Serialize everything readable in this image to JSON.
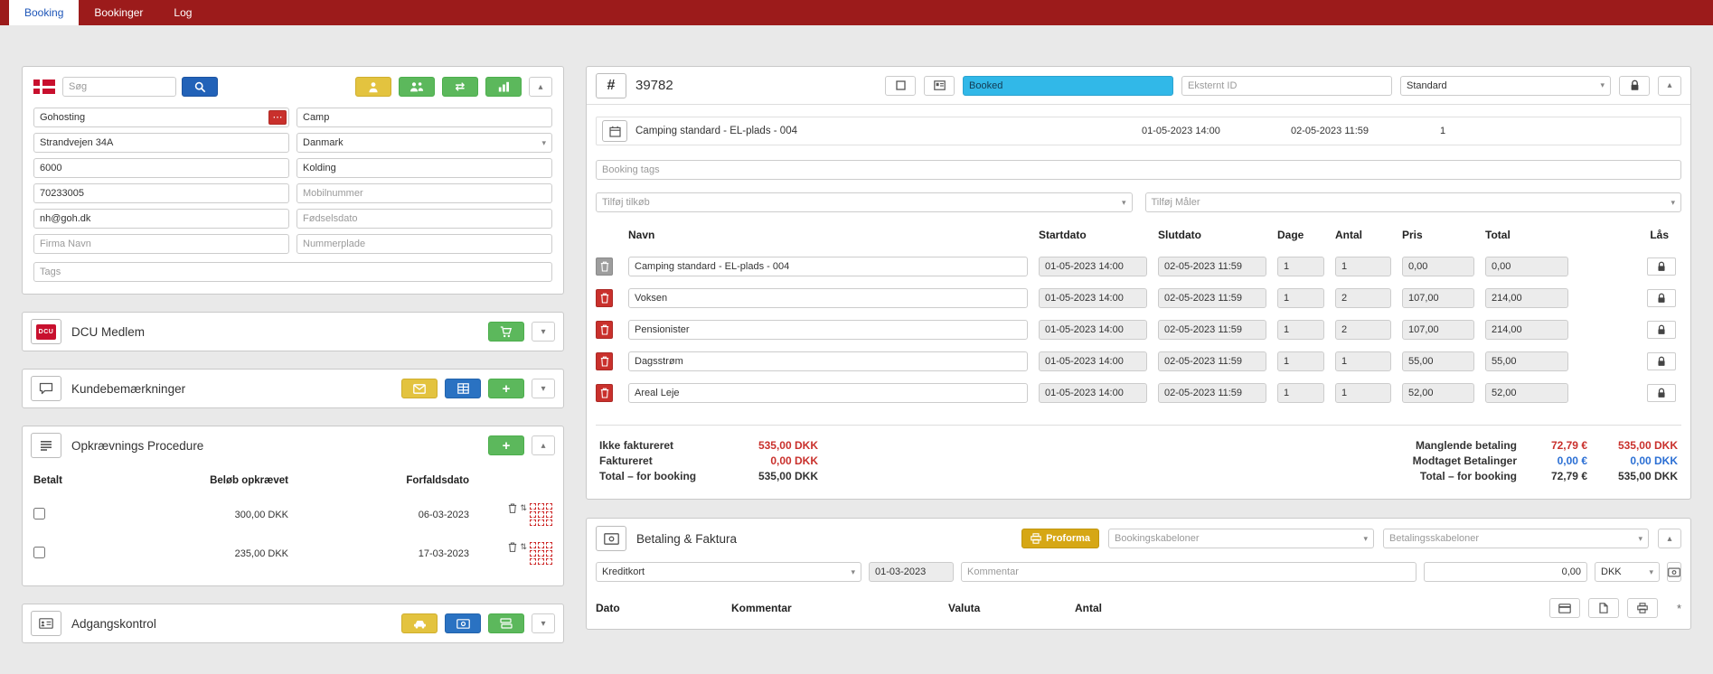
{
  "nav": {
    "tabs": [
      {
        "label": "Booking"
      },
      {
        "label": "Bookinger"
      },
      {
        "label": "Log"
      }
    ]
  },
  "icons": {
    "caret_down": "▾",
    "caret_up": "▴",
    "transfer": "⇄",
    "plus": "+",
    "dots_menu": "⋯",
    "sort": "⇅",
    "hash": "#",
    "star": "*"
  },
  "colors": {
    "topbar": "#9c1b1b",
    "accent_green": "#5cb85c",
    "accent_blue": "#2a72c2",
    "accent_yellow": "#e3c33f",
    "status_booked": "#31b8e8",
    "negative_red": "#c9302c",
    "payment_blue": "#2b6fd4",
    "proforma_gold": "#d6a715"
  },
  "customer": {
    "search_placeholder": "Søg",
    "name": "Gohosting",
    "camp": "Camp",
    "address": "Strandvejen 34A",
    "country": "Danmark",
    "zip": "6000",
    "city": "Kolding",
    "phone": "70233005",
    "mobile_placeholder": "Mobilnummer",
    "email": "nh@goh.dk",
    "birthdate_placeholder": "Fødselsdato",
    "company_placeholder": "Firma Navn",
    "plate_placeholder": "Nummerplade",
    "tags_placeholder": "Tags"
  },
  "dcu": {
    "title": "DCU Medlem"
  },
  "remarks": {
    "title": "Kundebemærkninger"
  },
  "collection": {
    "title": "Opkrævnings Procedure",
    "columns": {
      "paid": "Betalt",
      "amount": "Beløb opkrævet",
      "due": "Forfaldsdato"
    },
    "rows": [
      {
        "amount": "300,00 DKK",
        "due": "06-03-2023"
      },
      {
        "amount": "235,00 DKK",
        "due": "17-03-2023"
      }
    ]
  },
  "access": {
    "title": "Adgangskontrol"
  },
  "booking": {
    "number": "39782",
    "status": "Booked",
    "external_id_placeholder": "Eksternt ID",
    "type": "Standard",
    "unit": {
      "name": "Camping standard - EL-plads - 004",
      "start": "01-05-2023 14:00",
      "end": "02-05-2023 11:59",
      "count": "1"
    },
    "tags_placeholder": "Booking tags",
    "addon_placeholder": "Tilføj tilkøb",
    "meter_placeholder": "Tilføj Måler",
    "columns": {
      "name": "Navn",
      "start": "Startdato",
      "end": "Slutdato",
      "days": "Dage",
      "qty": "Antal",
      "price": "Pris",
      "total": "Total",
      "lock": "Lås"
    },
    "lines": [
      {
        "name": "Camping standard - EL-plads - 004",
        "start": "01-05-2023 14:00",
        "end": "02-05-2023 11:59",
        "days": "1",
        "qty": "1",
        "price": "0,00",
        "total": "0,00"
      },
      {
        "name": "Voksen",
        "start": "01-05-2023 14:00",
        "end": "02-05-2023 11:59",
        "days": "1",
        "qty": "2",
        "price": "107,00",
        "total": "214,00"
      },
      {
        "name": "Pensionister",
        "start": "01-05-2023 14:00",
        "end": "02-05-2023 11:59",
        "days": "1",
        "qty": "2",
        "price": "107,00",
        "total": "214,00"
      },
      {
        "name": "Dagsstrøm",
        "start": "01-05-2023 14:00",
        "end": "02-05-2023 11:59",
        "days": "1",
        "qty": "1",
        "price": "55,00",
        "total": "55,00"
      },
      {
        "name": "Areal Leje",
        "start": "01-05-2023 14:00",
        "end": "02-05-2023 11:59",
        "days": "1",
        "qty": "1",
        "price": "52,00",
        "total": "52,00"
      }
    ],
    "totals_left": [
      {
        "label": "Ikke faktureret",
        "value": "535,00 DKK"
      },
      {
        "label": "Faktureret",
        "value": "0,00 DKK"
      },
      {
        "label": "Total – for booking",
        "value": "535,00 DKK"
      }
    ],
    "totals_right": [
      {
        "label": "Manglende betaling",
        "eur": "72,79 €",
        "dkk": "535,00 DKK"
      },
      {
        "label": "Modtaget Betalinger",
        "eur": "0,00 €",
        "dkk": "0,00 DKK"
      },
      {
        "label": "Total – for booking",
        "eur": "72,79 €",
        "dkk": "535,00 DKK"
      }
    ]
  },
  "payment": {
    "title": "Betaling & Faktura",
    "proforma": "Proforma",
    "booking_templates_placeholder": "Bookingskabeloner",
    "payment_templates_placeholder": "Betalingsskabeloner",
    "method": "Kreditkort",
    "date": "01-03-2023",
    "comment_placeholder": "Kommentar",
    "amount": "0,00",
    "currency": "DKK",
    "columns": {
      "date": "Dato",
      "comment": "Kommentar",
      "currency": "Valuta",
      "qty": "Antal"
    }
  }
}
